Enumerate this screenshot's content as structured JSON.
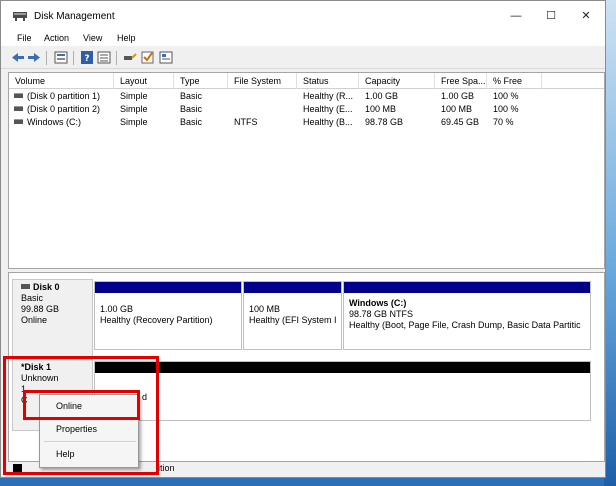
{
  "window": {
    "title": "Disk Management",
    "min_icon": "—",
    "max_icon": "☐",
    "close_icon": "✕"
  },
  "menu": [
    "File",
    "Action",
    "View",
    "Help"
  ],
  "toolbar_icons": [
    "back-arrow-icon",
    "forward-arrow-icon",
    "disk-list-icon",
    "help-icon",
    "volume-list-icon",
    "connect-icon",
    "check-icon",
    "properties-icon"
  ],
  "volume_list": {
    "columns": [
      "Volume",
      "Layout",
      "Type",
      "File System",
      "Status",
      "Capacity",
      "Free Spa...",
      "% Free"
    ],
    "rows": [
      [
        "(Disk 0 partition 1)",
        "Simple",
        "Basic",
        "",
        "Healthy (R...",
        "1.00 GB",
        "1.00 GB",
        "100 %"
      ],
      [
        "(Disk 0 partition 2)",
        "Simple",
        "Basic",
        "",
        "Healthy (E...",
        "100 MB",
        "100 MB",
        "100 %"
      ],
      [
        "Windows (C:)",
        "Simple",
        "Basic",
        "NTFS",
        "Healthy (B...",
        "98.78 GB",
        "69.45 GB",
        "70 %"
      ]
    ]
  },
  "disks": {
    "disk0": {
      "name": "Disk 0",
      "type": "Basic",
      "size": "99.88 GB",
      "status": "Online",
      "partitions": [
        {
          "title": "",
          "line1": "1.00 GB",
          "line2": "Healthy (Recovery Partition)"
        },
        {
          "title": "",
          "line1": "100 MB",
          "line2": "Healthy (EFI System I"
        },
        {
          "title": "Windows  (C:)",
          "line1": "98.78 GB NTFS",
          "line2": "Healthy (Boot, Page File, Crash Dump, Basic Data Partitic"
        }
      ]
    },
    "disk1": {
      "name": "*Disk 1",
      "type": "Unknown",
      "size_partial": "1",
      "status_partial": "C",
      "part_partial": "d",
      "legend_partial": "ition"
    }
  },
  "context_menu": {
    "items": [
      "Online",
      "Properties",
      "Help"
    ]
  },
  "colors": {
    "partition_bar": "#00008b",
    "unallocated_bar": "#000000",
    "highlight": "#e00000"
  }
}
